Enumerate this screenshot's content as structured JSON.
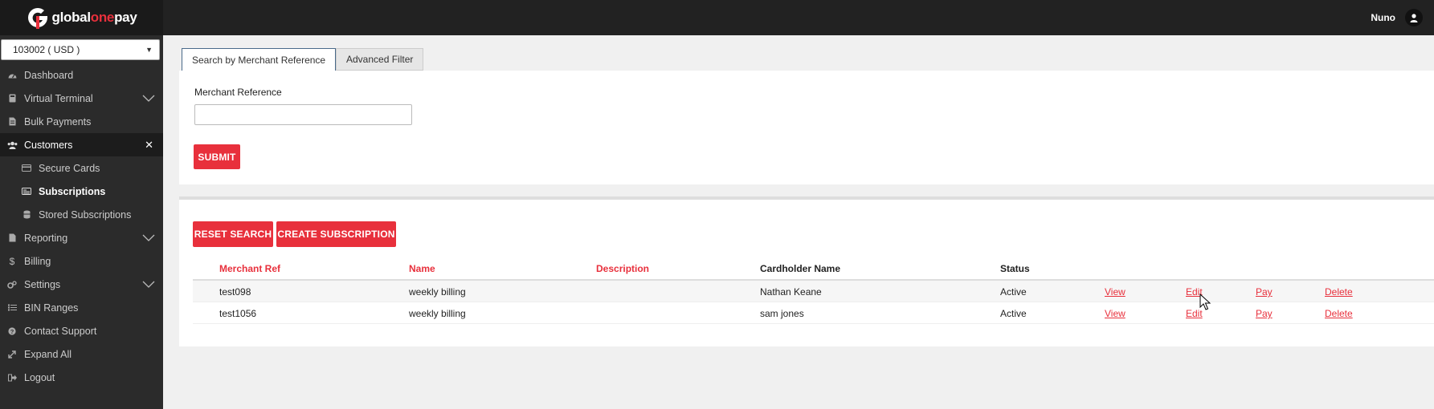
{
  "brand": {
    "logo_main": "global",
    "logo_accent": "one",
    "logo_end": "pay",
    "accent_color": "#e8303c"
  },
  "header": {
    "user_name": "Nuno",
    "user_icon": "user-icon"
  },
  "sidebar": {
    "account_select": "103002 ( USD )",
    "items": [
      {
        "label": "Dashboard",
        "icon": "dashboard-icon"
      },
      {
        "label": "Virtual Terminal",
        "icon": "calculator-icon"
      },
      {
        "label": "Bulk Payments",
        "icon": "file-icon"
      },
      {
        "label": "Customers",
        "icon": "users-icon"
      },
      {
        "label": "Secure Cards",
        "icon": "credit-card-icon"
      },
      {
        "label": "Subscriptions",
        "icon": "id-card-icon"
      },
      {
        "label": "Stored Subscriptions",
        "icon": "database-icon"
      },
      {
        "label": "Reporting",
        "icon": "report-icon"
      },
      {
        "label": "Billing",
        "icon": "dollar-icon"
      },
      {
        "label": "Settings",
        "icon": "gears-icon"
      },
      {
        "label": "BIN Ranges",
        "icon": "list-icon"
      },
      {
        "label": "Contact Support",
        "icon": "question-icon"
      },
      {
        "label": "Expand All",
        "icon": "expand-icon"
      },
      {
        "label": "Logout",
        "icon": "logout-icon"
      }
    ]
  },
  "search": {
    "tabs": [
      "Search by Merchant Reference",
      "Advanced Filter"
    ],
    "field_label": "Merchant Reference",
    "field_value": "",
    "submit_label": "SUBMIT"
  },
  "results": {
    "reset_label": "RESET SEARCH",
    "create_label": "CREATE SUBSCRIPTION",
    "columns": [
      "Merchant Ref",
      "Name",
      "Description",
      "Cardholder Name",
      "Status"
    ],
    "rows": [
      {
        "ref": "test098",
        "name": "weekly billing",
        "description": "",
        "cardholder": "Nathan Keane",
        "status": "Active",
        "view": "View",
        "edit": "Edit",
        "pay": "Pay",
        "delete": "Delete"
      },
      {
        "ref": "test1056",
        "name": "weekly billing",
        "description": "",
        "cardholder": "sam jones",
        "status": "Active",
        "view": "View",
        "edit": "Edit",
        "pay": "Pay",
        "delete": "Delete"
      }
    ]
  }
}
